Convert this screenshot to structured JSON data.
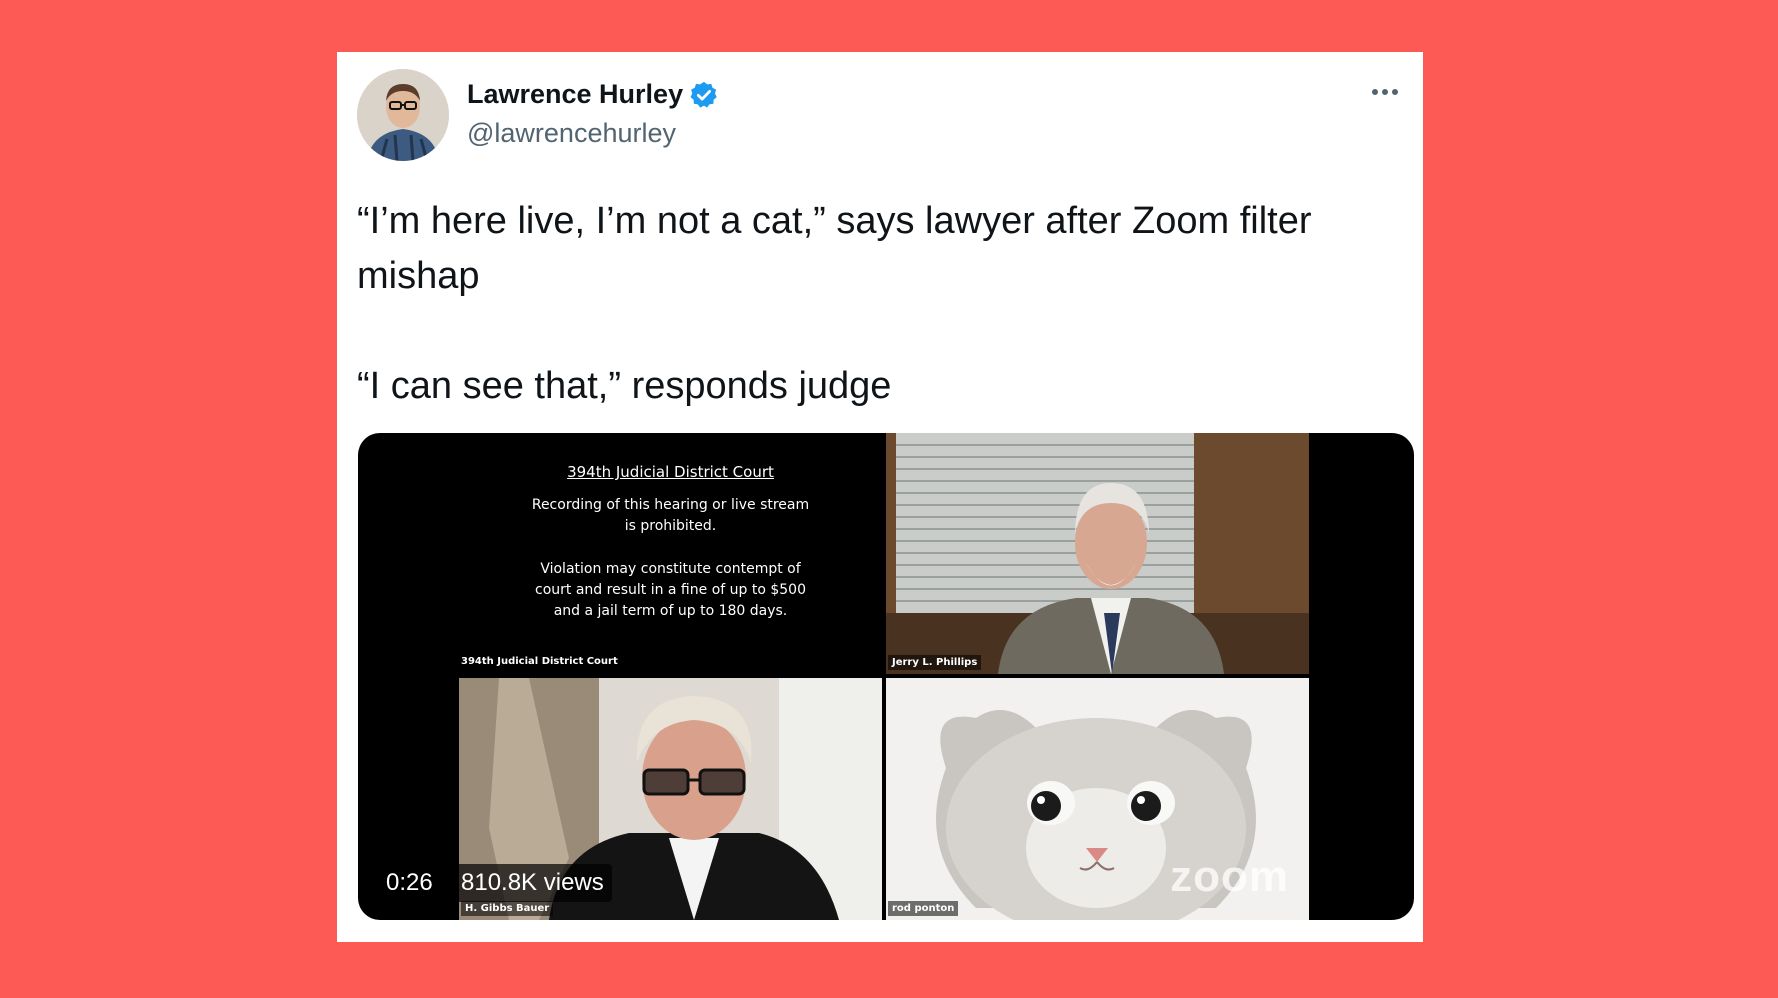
{
  "tweet": {
    "display_name": "Lawrence Hurley",
    "handle": "@lawrencehurley",
    "text_lines": [
      "“I’m here live, I’m not a cat,” says lawyer after Zoom filter mishap",
      "“I can see that,” responds judge"
    ]
  },
  "video": {
    "timestamp": "0:26",
    "views": "810.8K views",
    "court_panel": {
      "title": "394th Judicial District Court",
      "line1a": "Recording of this hearing or live stream",
      "line1b": "is prohibited.",
      "line2a": "Violation may constitute contempt of",
      "line2b": "court and result in a fine of up to $500",
      "line2c": "and a jail term of up to 180 days.",
      "caption": "394th Judicial District Court"
    },
    "participants": {
      "judge": "Jerry L. Phillips",
      "lawyer": "H. Gibbs Bauer",
      "cat": "rod ponton"
    },
    "watermark": "zoom"
  },
  "colors": {
    "background": "#fd5a55",
    "card": "#ffffff",
    "verified": "#1d9bf0",
    "secondary_text": "#536471"
  },
  "icons": [
    "verified-badge-icon",
    "more-options-icon"
  ]
}
